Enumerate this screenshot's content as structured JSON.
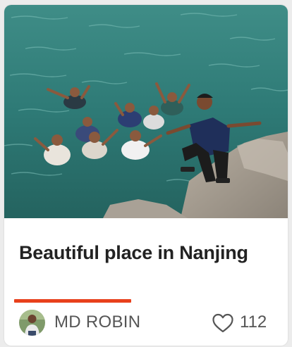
{
  "post": {
    "title": "Beautiful place in Nanjing",
    "author_name": "MD ROBIN",
    "likes": "112",
    "accent_color": "#e8401c",
    "image_subject": "group of friends in turquoise river water"
  },
  "icons": {
    "like": "heart-outline-icon"
  }
}
